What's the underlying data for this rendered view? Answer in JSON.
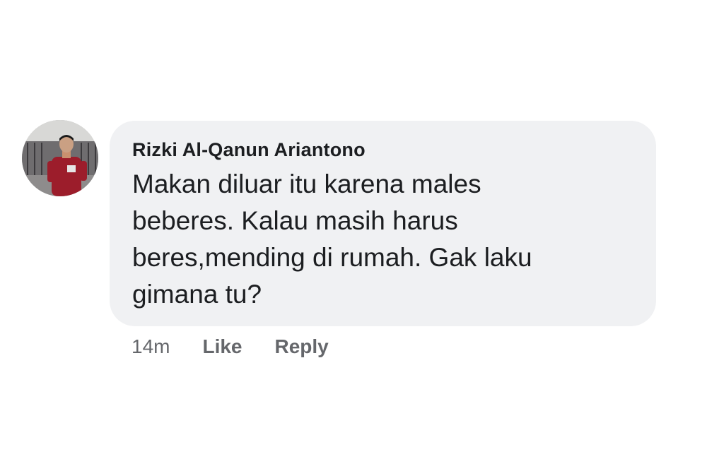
{
  "comment": {
    "author": "Rizki Al-Qanun Ariantono",
    "text": "Makan diluar itu karena males\nbeberes. Kalau masih harus\nberes,mending di rumah. Gak laku\ngimana tu?",
    "time": "14m",
    "like_label": "Like",
    "reply_label": "Reply"
  },
  "colors": {
    "bubble": "#f0f1f3",
    "text": "#1c1e21",
    "meta": "#65676b"
  }
}
